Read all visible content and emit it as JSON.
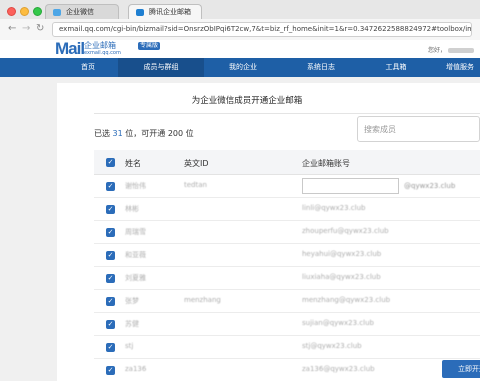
{
  "browser": {
    "tabs": [
      {
        "label": "企业微信"
      },
      {
        "label": "腾讯企业邮箱"
      }
    ],
    "url": "exmail.qq.com/cgi-bin/bizmail?sid=OnsrzObIPqi6T2cw,7&t=biz_rf_home&init=1&r=0.3472622588824972#toolbox/import_crtx"
  },
  "header": {
    "logo_mail": "Mail",
    "logo_cn": "企业邮箱",
    "logo_domain": "exmail.qq.com",
    "logo_badge": "专属版",
    "greeting": "您好，"
  },
  "nav": {
    "items": [
      "首页",
      "成员与群组",
      "我的企业",
      "系统日志",
      "工具箱",
      "增值服务"
    ]
  },
  "main": {
    "title": "为企业微信成员开通企业邮箱",
    "stats": {
      "prefix": "已选",
      "selected": "31",
      "middle": "位，可开通",
      "quota": "200",
      "suffix": "位"
    },
    "search_placeholder": "搜索成员",
    "columns": {
      "name": "姓名",
      "english_id": "英文ID",
      "account": "企业邮箱账号"
    },
    "rows": [
      {
        "name": "谢怡伟",
        "english_id": "tedtan",
        "account": "",
        "account_suffix": "@qywx23.club"
      },
      {
        "name": "林彬",
        "english_id": "",
        "account": "linli@qywx23.club"
      },
      {
        "name": "周瑞雪",
        "english_id": "",
        "account": "zhouperfu@qywx23.club"
      },
      {
        "name": "和亚薇",
        "english_id": "",
        "account": "heyahui@qywx23.club"
      },
      {
        "name": "刘夏雅",
        "english_id": "",
        "account": "liuxiaha@qywx23.club"
      },
      {
        "name": "张梦",
        "english_id": "menzhang",
        "account": "menzhang@qywx23.club"
      },
      {
        "name": "苏健",
        "english_id": "",
        "account": "sujian@qywx23.club"
      },
      {
        "name": "stj",
        "english_id": "",
        "account": "stj@qywx23.club"
      },
      {
        "name": "za136",
        "english_id": "",
        "account": "za136@qywx23.club"
      }
    ],
    "submit_label": "立即开通"
  },
  "colors": {
    "brand": "#2b6cb9",
    "navbar": "#1e5fa6"
  }
}
